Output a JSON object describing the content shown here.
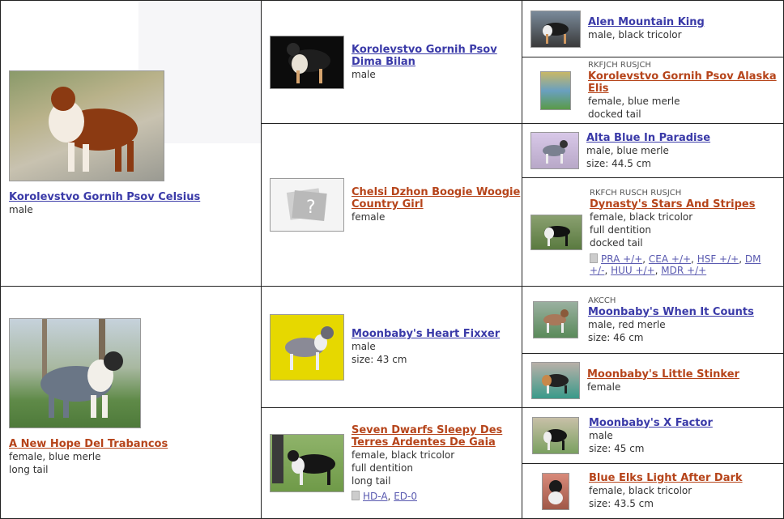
{
  "gen1": [
    {
      "name": "Korolevstvo Gornih Psov Celsius",
      "sex": "male",
      "details": [],
      "color": "m"
    },
    {
      "name": "A New Hope Del Trabancos",
      "sex": "female, blue merle",
      "details": [
        "long tail"
      ],
      "color": "f"
    }
  ],
  "gen2": [
    {
      "name": "Korolevstvo Gornih Psov Dima Bilan",
      "sex": "male",
      "details": []
    },
    {
      "name": "Chelsi Dzhon Boogie Woogie Country Girl",
      "sex": "female",
      "details": []
    },
    {
      "name": "Moonbaby's Heart Fixxer",
      "sex": "male",
      "details": [
        "size: 43 cm"
      ]
    },
    {
      "name": "Seven Dwarfs Sleepy Des Terres Ardentes De Gaia",
      "sex": "female, black tricolor",
      "details": [
        "full dentition",
        "long tail"
      ],
      "tests": [
        "HD-A",
        "ED-0"
      ]
    }
  ],
  "gen3": [
    {
      "title": "",
      "name": "Alen Mountain King",
      "sex": "male, black tricolor",
      "details": []
    },
    {
      "title": "RKFJCH RUSJCH",
      "name": "Korolevstvo Gornih Psov Alaska Elis",
      "sex": "female, blue merle",
      "details": [
        "docked tail"
      ]
    },
    {
      "title": "",
      "name": "Alta Blue In Paradise",
      "sex": "male, blue merle",
      "details": [
        "size: 44.5 cm"
      ]
    },
    {
      "title": "RKFCH RUSCH RUSJCH",
      "name": "Dynasty's Stars And Stripes",
      "sex": "female, black tricolor",
      "details": [
        "full dentition",
        "docked tail"
      ],
      "tests": [
        "PRA +/+",
        "CEA +/+",
        "HSF +/+",
        "DM +/-",
        "HUU +/+",
        "MDR +/+"
      ]
    },
    {
      "title": "AKCCH",
      "name": "Moonbaby's When It Counts",
      "sex": "male, red merle",
      "details": [
        "size: 46 cm"
      ]
    },
    {
      "title": "",
      "name": "Moonbaby's Little Stinker",
      "sex": "female",
      "details": []
    },
    {
      "title": "",
      "name": "Moonbaby's X Factor",
      "sex": "male",
      "details": [
        "size: 45 cm"
      ]
    },
    {
      "title": "",
      "name": "Blue Elks Light After Dark",
      "sex": "female, black tricolor",
      "details": [
        "size: 43.5 cm"
      ]
    }
  ],
  "icons": {
    "tests": "document-icon",
    "placeholder": "photo-placeholder-icon"
  }
}
